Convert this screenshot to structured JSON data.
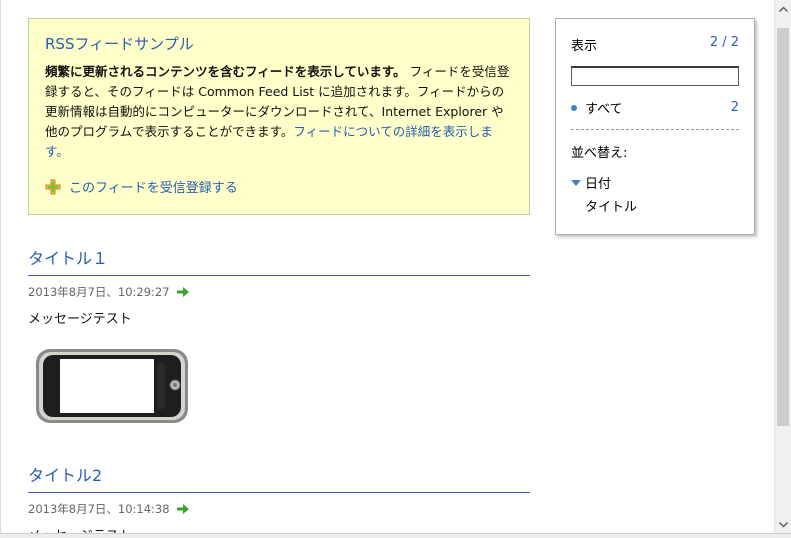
{
  "infobox": {
    "title": "RSSフィードサンプル",
    "desc_bold": "頻繁に更新されるコンテンツを含むフィードを表示しています。",
    "desc_text": " フィードを受信登録すると、そのフィードは Common Feed List に追加されます。フィードからの更新情報は自動的にコンピューターにダウンロードされて、Internet Explorer や他のプログラムで表示することができます。",
    "desc_link": "フィードについての詳細を表示します。",
    "subscribe_label": "このフィードを受信登録する"
  },
  "entries": [
    {
      "title": "タイトル１",
      "date": "2013年8月7日、10:29:27",
      "body": "メッセージテスト"
    },
    {
      "title": "タイトル2",
      "date": "2013年8月7日、10:14:38",
      "body": "メッセージテスト"
    }
  ],
  "sidepanel": {
    "display_label": "表示",
    "count": "2 / 2",
    "search_value": "",
    "all_label": "すべて",
    "all_count": "2",
    "sort_label": "並べ替え:",
    "sort_date": "日付",
    "sort_title": "タイトル"
  },
  "colors": {
    "accent": "#2a5db0",
    "infobox_bg": "#ffffc9",
    "dot": "#3d84c6",
    "arrow": "#3aa329"
  },
  "icons": [
    "subscribe-plus-icon",
    "green-arrow-icon",
    "phone-image",
    "sort-triangle-icon",
    "scroll-up-icon",
    "scroll-down-icon"
  ]
}
